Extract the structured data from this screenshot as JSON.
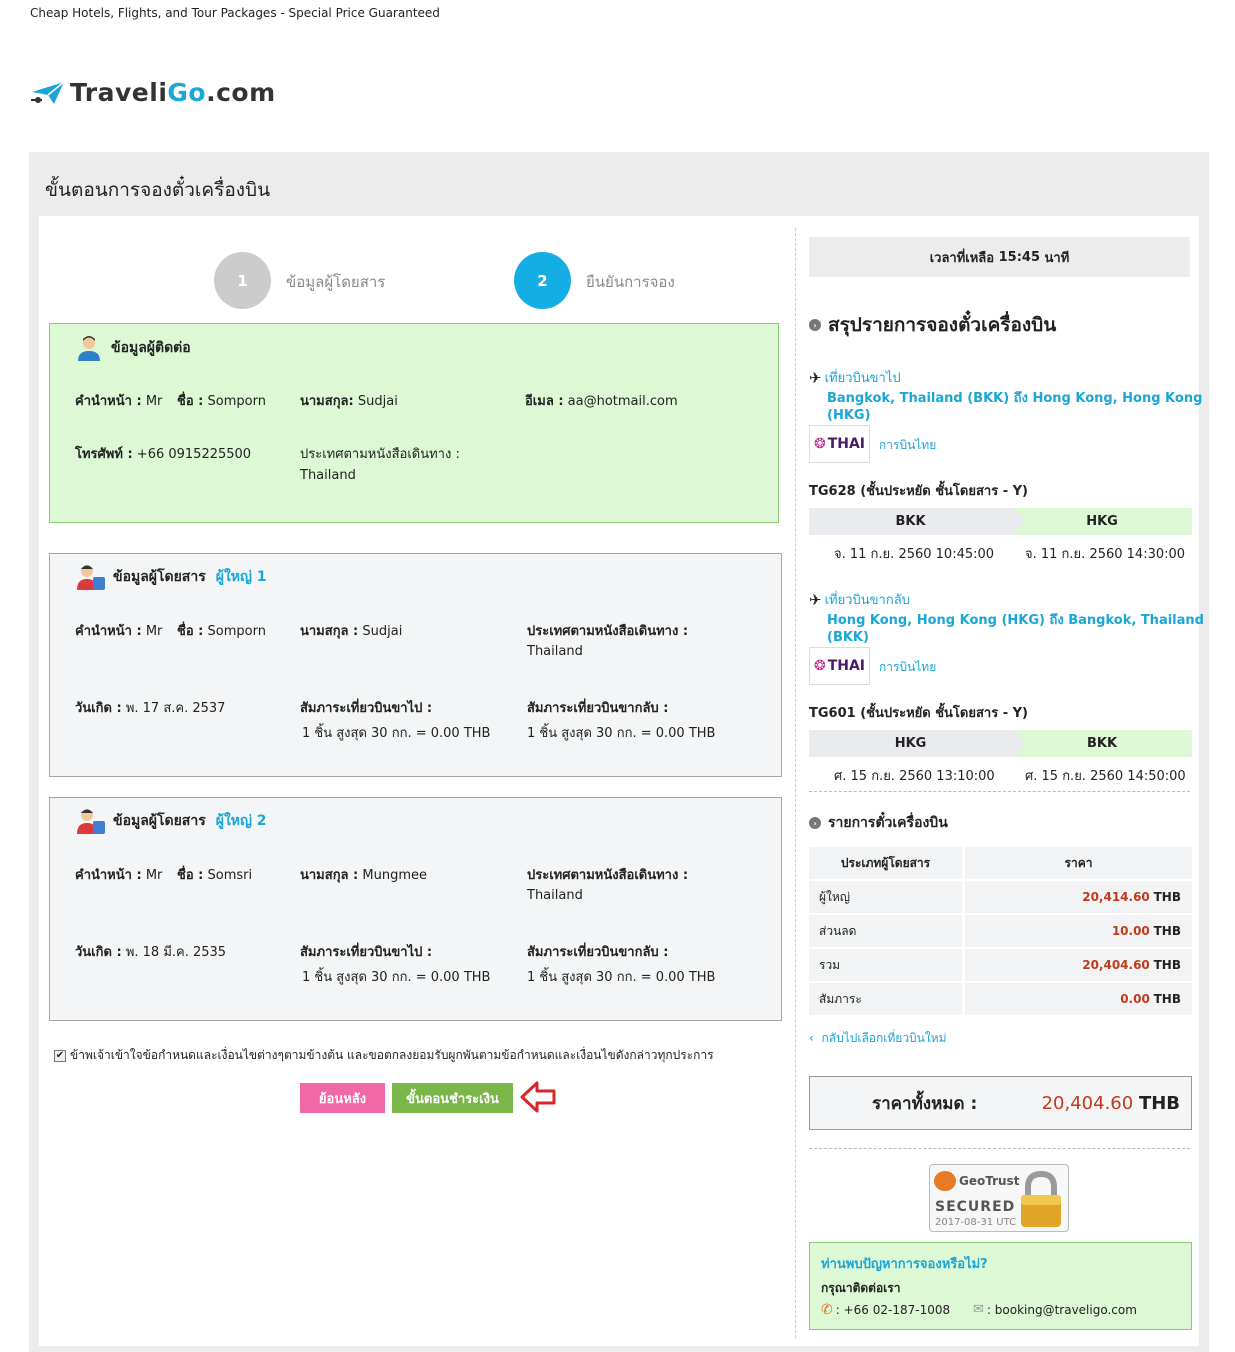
{
  "site": {
    "tagline": "Cheap Hotels, Flights, and Tour Packages - Special Price Guaranteed",
    "logo_main": "Traveli",
    "logo_hl": "Go",
    "logo_tail": ".com"
  },
  "page": {
    "title": "ขั้นตอนการจองตั๋วเครื่องบิน"
  },
  "steps": [
    {
      "num": "1",
      "label": "ข้อมูลผู้โดยสาร",
      "color": "#cccccc"
    },
    {
      "num": "2",
      "label": "ยืนยันการจอง",
      "color": "#14aee4"
    }
  ],
  "contact": {
    "heading": "ข้อมูลผู้ติดต่อ",
    "prefix_label": "คำนำหน้า :",
    "prefix": "Mr",
    "first_label": "ชื่อ :",
    "first": "Somporn",
    "last_label": "นามสกุล:",
    "last": "Sudjai",
    "email_label": "อีเมล :",
    "email": "aa@hotmail.com",
    "phone_label": "โทรศัพท์ :",
    "phone": "+66 0915225500",
    "passport_label": "ประเทศตามหนังสือเดินทาง :",
    "passport": "Thailand"
  },
  "passengers": [
    {
      "heading": "ข้อมูลผู้โดยสาร",
      "type": "ผู้ใหญ่ 1",
      "prefix_label": "คำนำหน้า :",
      "prefix": "Mr",
      "first_label": "ชื่อ :",
      "first": "Somporn",
      "last_label": "นามสกุล :",
      "last": "Sudjai",
      "passport_label": "ประเทศตามหนังสือเดินทาง :",
      "passport": "Thailand",
      "dob_label": "วันเกิด :",
      "dob": "พ. 17 ส.ค. 2537",
      "bag_out_label": "สัมภาระเที่ยวบินขาไป :",
      "bag_out": "1 ชิ้น สูงสุด 30 กก. = 0.00 THB",
      "bag_ret_label": "สัมภาระเที่ยวบินขากลับ :",
      "bag_ret": "1 ชิ้น สูงสุด 30 กก. = 0.00 THB"
    },
    {
      "heading": "ข้อมูลผู้โดยสาร",
      "type": "ผู้ใหญ่ 2",
      "prefix_label": "คำนำหน้า :",
      "prefix": "Mr",
      "first_label": "ชื่อ :",
      "first": "Somsri",
      "last_label": "นามสกุล :",
      "last": "Mungmee",
      "passport_label": "ประเทศตามหนังสือเดินทาง :",
      "passport": "Thailand",
      "dob_label": "วันเกิด :",
      "dob": "พ. 18 มี.ค. 2535",
      "bag_out_label": "สัมภาระเที่ยวบินขาไป :",
      "bag_out": "1 ชิ้น สูงสุด 30 กก. = 0.00 THB",
      "bag_ret_label": "สัมภาระเที่ยวบินขากลับ :",
      "bag_ret": "1 ชิ้น สูงสุด 30 กก. = 0.00 THB"
    }
  ],
  "agree": {
    "checked": "✔",
    "text": "ข้าพเจ้าเข้าใจข้อกำหนดและเงื่อนไขต่างๆตามข้างต้น และขอตกลงยอมรับผูกพันตามข้อกำหนดและเงื่อนไขดังกล่าวทุกประการ"
  },
  "buttons": {
    "back": "ย้อนหลัง",
    "pay": "ขั้นตอนชำระเงิน"
  },
  "summary": {
    "timer_prefix": "เวลาที่เหลือ",
    "timer_value": "15:45",
    "timer_suffix": "นาที",
    "title": "สรุปรายการจองตั๋วเครื่องบิน",
    "flights": [
      {
        "dir_label": "เที่ยวบินขาไป",
        "route": "Bangkok, Thailand (BKK) ถึง Hong Kong, Hong Kong (HKG)",
        "airline_logo": "THAI",
        "airline_name": "การบินไทย",
        "flight_no": "TG628 (ชั้นประหยัด ชั้นโดยสาร - Y)",
        "from": "BKK",
        "to": "HKG",
        "dep": "จ. 11 ก.ย. 2560 10:45:00",
        "arr": "จ. 11 ก.ย. 2560 14:30:00"
      },
      {
        "dir_label": "เที่ยวบินขากลับ",
        "route": "Hong Kong, Hong Kong (HKG) ถึง Bangkok, Thailand (BKK)",
        "airline_logo": "THAI",
        "airline_name": "การบินไทย",
        "flight_no": "TG601 (ชั้นประหยัด ชั้นโดยสาร - Y)",
        "from": "HKG",
        "to": "BKK",
        "dep": "ศ. 15 ก.ย. 2560 13:10:00",
        "arr": "ศ. 15 ก.ย. 2560 14:50:00"
      }
    ],
    "tickets_title": "รายการตั๋วเครื่องบิน",
    "col_type": "ประเภทผู้โดยสาร",
    "col_price": "ราคา",
    "rows": [
      {
        "label": "ผู้ใหญ่",
        "amount": "20,414.60",
        "cur": "THB"
      },
      {
        "label": "ส่วนลด",
        "amount": "10.00",
        "cur": "THB"
      },
      {
        "label": "รวม",
        "amount": "20,404.60",
        "cur": "THB"
      },
      {
        "label": "สัมภาระ",
        "amount": "0.00",
        "cur": "THB"
      }
    ],
    "back_link": "กลับไปเลือกเที่ยวบินใหม่",
    "total_label": "ราคาทั้งหมด :",
    "total_amount": "20,404.60",
    "total_cur": "THB"
  },
  "secure": {
    "brand": "GeoTrust",
    "text": "SECURED",
    "date": "2017-08-31 UTC"
  },
  "help": {
    "title": "ท่านพบปัญหาการจองหรือไม่?",
    "sub": "กรุณาติดต่อเรา",
    "phone": ": +66 02-187-1008",
    "email": ": booking@traveligo.com"
  },
  "colors": {
    "accent": "#1aa6d6",
    "green_panel": "#dcf8d4",
    "pink_button": "#f069a6",
    "green_button": "#7ab648",
    "price_red": "#c23a1a",
    "arrow_red": "#d9242a"
  },
  "icons": [
    "plane-logo-icon",
    "contact-person-icon",
    "passenger-icon",
    "plane-icon",
    "arrow-left-icon",
    "phone-icon",
    "mail-icon",
    "lock-icon"
  ]
}
